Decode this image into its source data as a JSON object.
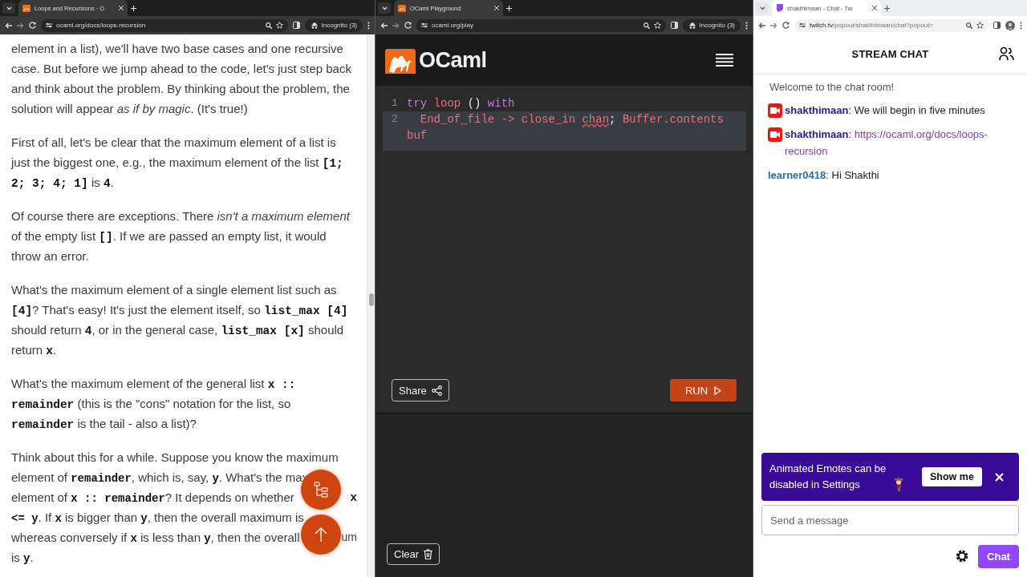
{
  "article_window": {
    "browser": {
      "tab_title": "Loops and Recursions · O",
      "url": "ocaml.org/docs/loops-recursion",
      "profile": "Incognito (3)"
    },
    "paragraphs": [
      {
        "kind": "text",
        "text": "element in a list), we'll have two base cases and one recursive case. But before we jump ahead to the code, let's just step back and think about the problem. By thinking about the problem, the solution will appear *as if by magic*. (It's true!)"
      },
      {
        "kind": "text",
        "text": "First of all, let's be clear that the maximum element of a list is just the biggest one, e.g., the maximum element of the list **[1; 2; 3; 4; 1]** is **4**."
      },
      {
        "kind": "text",
        "text": "Of course there are exceptions. There *isn't a maximum element* of the empty list **[]**. If we are passed an empty list, it would throw an error."
      },
      {
        "kind": "text",
        "text": "What's the maximum element of a single element list such as **[4]**? That's easy! It's just the element itself, so **list_max [4]** should return **4**, or in the general case, **list_max [x]** should return **x**."
      },
      {
        "kind": "text",
        "text": "What's the maximum element of the general list **x :: remainder** (this is the \"cons\" notation for the list, so **remainder** is the tail - also a list)?"
      },
      {
        "kind": "lines",
        "lines": [
          {
            "left": "Think about this for a while. Suppose you know the maximum"
          },
          {
            "left": "element of **remainder**, which is, say, **y**. What's the max"
          },
          {
            "left": "element of **x :: remainder**? It depends on whether",
            "right": "**x**"
          },
          {
            "left": "**<= y**. If **x** is bigger than **y**, then the overall maximum is"
          },
          {
            "left": "whereas conversely if **x** is less than **y**, then the overall",
            "right": "um"
          },
          {
            "left": "is **y**."
          }
        ]
      }
    ]
  },
  "playground_window": {
    "browser": {
      "tab_title": "OCaml Playground",
      "url": "ocaml.org/play",
      "profile": "Incognito (3)"
    },
    "logo_text": "OCaml",
    "editor": {
      "lines": [
        {
          "number": "1",
          "selected": false,
          "tokens": [
            {
              "text": "try",
              "kind": "keyword"
            },
            {
              "text": " loop",
              "kind": "ident"
            },
            {
              "text": " () ",
              "kind": "plain"
            },
            {
              "text": "with",
              "kind": "keyword"
            }
          ]
        },
        {
          "number": "2",
          "selected": true,
          "tokens": [
            {
              "text": "  End_of_file -> close_in ",
              "kind": "ident"
            },
            {
              "text": "chan",
              "kind": "ident",
              "error": true
            },
            {
              "text": "; ",
              "kind": "plain"
            },
            {
              "text": "Buffer.contents buf",
              "kind": "ident"
            }
          ]
        }
      ]
    },
    "share_button": "Share",
    "run_button": "RUN",
    "clear_button": "Clear"
  },
  "chat_window": {
    "browser": {
      "tab_title": "shakthimaan - Chat - Tw",
      "url": "**twitch.tv**/popout/shakthimaan/chat?popout="
    },
    "title": "STREAM CHAT",
    "messages": [
      {
        "kind": "system",
        "text": "Welcome to the chat room!"
      },
      {
        "kind": "user",
        "user": "shakthimaan",
        "color": "#1e1e9c",
        "broadcaster": true,
        "text": ": We will begin in five minutes"
      },
      {
        "kind": "user",
        "user": "shakthimaan",
        "color": "#1e1e9c",
        "broadcaster": true,
        "text": ":",
        "link": "https://ocaml.org/docs/loops-recursion"
      },
      {
        "kind": "user",
        "user": "learner0418",
        "color": "#2b6cb0",
        "broadcaster": false,
        "text": ": Hi Shakthi"
      }
    ],
    "banner": {
      "text": "Animated Emotes can be disabled in Settings",
      "button": "Show me"
    },
    "input": {
      "placeholder": "Send a message"
    },
    "chat_button": "Chat"
  }
}
